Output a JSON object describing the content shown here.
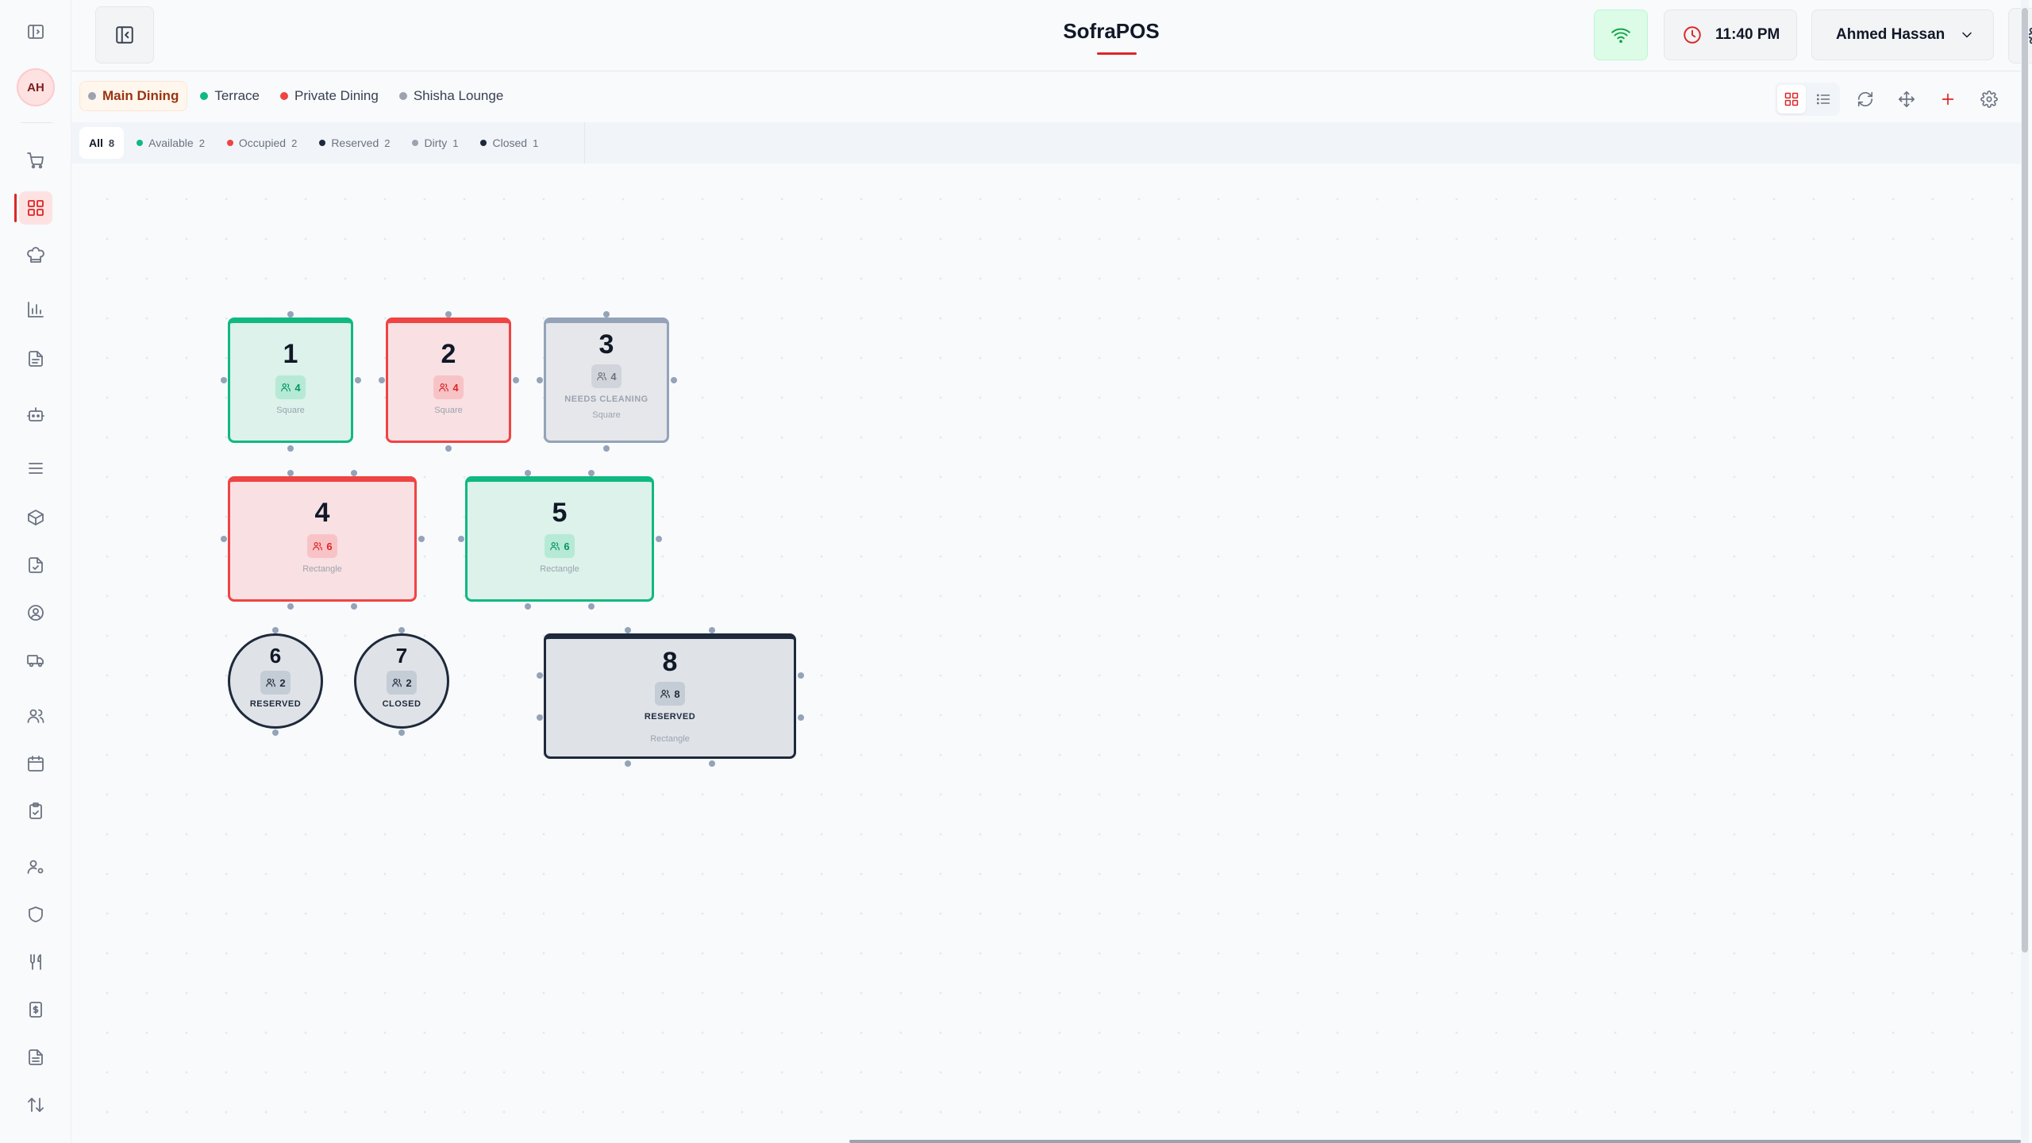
{
  "app": {
    "title": "SofraPOS"
  },
  "header": {
    "time": "11:40 PM",
    "user_name": "Ahmed Hassan",
    "avatar_initials": "AH"
  },
  "areas": [
    {
      "label": "Main Dining",
      "color": "#9ca3af",
      "active": true
    },
    {
      "label": "Terrace",
      "color": "#10b981",
      "active": false
    },
    {
      "label": "Private Dining",
      "color": "#ef4444",
      "active": false
    },
    {
      "label": "Shisha Lounge",
      "color": "#9ca3af",
      "active": false
    }
  ],
  "filters": [
    {
      "label": "All",
      "count": "8",
      "color": "",
      "active": true
    },
    {
      "label": "Available",
      "count": "2",
      "color": "#10b981",
      "active": false
    },
    {
      "label": "Occupied",
      "count": "2",
      "color": "#ef4444",
      "active": false
    },
    {
      "label": "Reserved",
      "count": "2",
      "color": "#1e293b",
      "active": false
    },
    {
      "label": "Dirty",
      "count": "1",
      "color": "#9ca3af",
      "active": false
    },
    {
      "label": "Closed",
      "count": "1",
      "color": "#1e293b",
      "active": false
    }
  ],
  "tables": [
    {
      "number": "1",
      "capacity": "4",
      "shape": "Square",
      "status": "available",
      "status_label": ""
    },
    {
      "number": "2",
      "capacity": "4",
      "shape": "Square",
      "status": "occupied",
      "status_label": ""
    },
    {
      "number": "3",
      "capacity": "4",
      "shape": "Square",
      "status": "dirty",
      "status_label": "NEEDS CLEANING"
    },
    {
      "number": "4",
      "capacity": "6",
      "shape": "Rectangle",
      "status": "occupied",
      "status_label": ""
    },
    {
      "number": "5",
      "capacity": "6",
      "shape": "Rectangle",
      "status": "available",
      "status_label": ""
    },
    {
      "number": "6",
      "capacity": "2",
      "shape": "",
      "status": "reserved",
      "status_label": "RESERVED"
    },
    {
      "number": "7",
      "capacity": "2",
      "shape": "",
      "status": "closed",
      "status_label": "CLOSED"
    },
    {
      "number": "8",
      "capacity": "8",
      "shape": "Rectangle",
      "status": "reserved",
      "status_label": "RESERVED"
    }
  ],
  "colors": {
    "accent": "#dc2626",
    "available": "#10b981",
    "occupied": "#ef4444",
    "reserved": "#1e293b",
    "dirty": "#94a3b8"
  },
  "sidebar_icons": [
    "cart-icon",
    "grid-icon",
    "chef-hat-icon",
    "bar-chart-icon",
    "document-icon",
    "robot-icon",
    "menu-list-icon",
    "package-icon",
    "file-check-icon",
    "user-circle-icon",
    "truck-icon",
    "users-icon",
    "calendar-icon",
    "clipboard-check-icon",
    "user-gear-icon",
    "shield-icon",
    "utensils-icon",
    "dollar-receipt-icon",
    "receipt-icon",
    "sort-arrows-icon"
  ]
}
